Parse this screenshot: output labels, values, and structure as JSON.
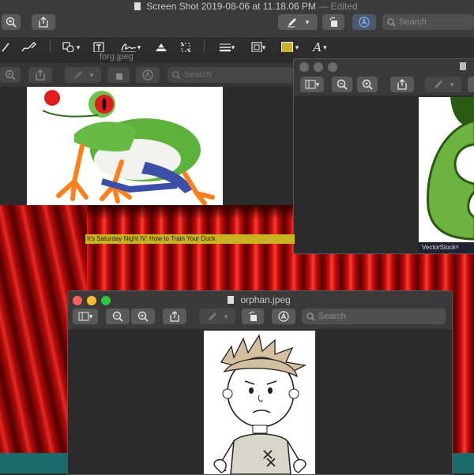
{
  "main_window": {
    "title": "Screen Shot 2019-08-06 at 11.18.06 PM",
    "edited_label": "— Edited",
    "search_placeholder": "Search"
  },
  "frog_window": {
    "title": "forg.jpeg",
    "search_placeholder": "Search"
  },
  "right_window": {
    "title_fragment": "",
    "watermark": "VectorStock",
    "watermark_mark": "®"
  },
  "orphan_window": {
    "title": "orphan.jpeg",
    "search_placeholder": "Search"
  },
  "caption": {
    "text": "It's Saturday Night IV: How to Train Your Duck"
  },
  "colors": {
    "caption_bg": "#c8b421",
    "toolbar_bg": "#3a3a3a",
    "window_bg": "#2b2b2b",
    "close": "#fe5f57",
    "minimize": "#febc2e",
    "zoom": "#28c840",
    "curtain_red": "#c40d0d"
  }
}
